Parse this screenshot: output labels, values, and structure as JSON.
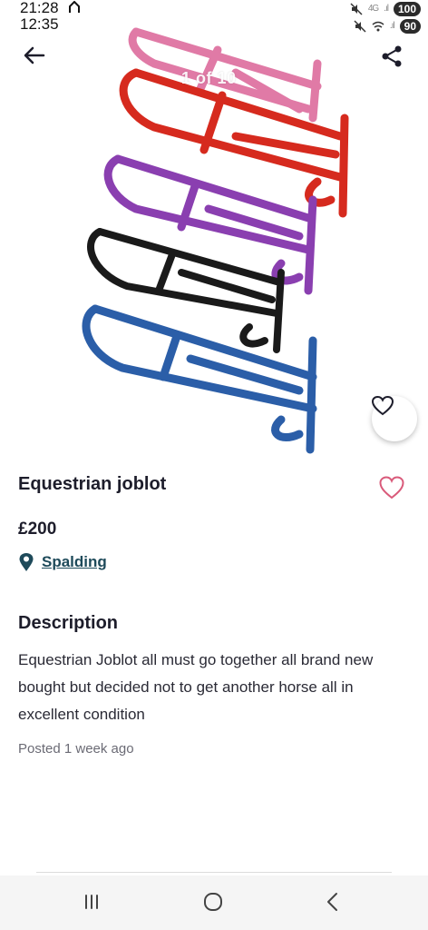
{
  "status_bar": {
    "time_primary": "21:28",
    "time_secondary": "12:35",
    "network_label": "4G",
    "battery_primary": "100",
    "battery_secondary": "90"
  },
  "gallery": {
    "counter": "1 of 10",
    "rack_colors": [
      "#e07aa6",
      "#d62a1e",
      "#8a3fb0",
      "#1a1a1a",
      "#2b5ea8"
    ]
  },
  "listing": {
    "title": "Equestrian joblot",
    "price": "£200",
    "location": "Spalding",
    "description_heading": "Description",
    "description": "Equestrian Joblot all must go together  all brand new bought but decided not to get another horse all in excellent condition",
    "posted": "Posted 1 week ago"
  },
  "icons": {
    "back": "arrow-left-icon",
    "share": "share-icon",
    "favourite": "heart-icon",
    "location": "map-pin-icon"
  },
  "colors": {
    "heart_outline": "#d95a7a",
    "location_text": "#1e4a5a",
    "pin": "#1e4a5a"
  }
}
